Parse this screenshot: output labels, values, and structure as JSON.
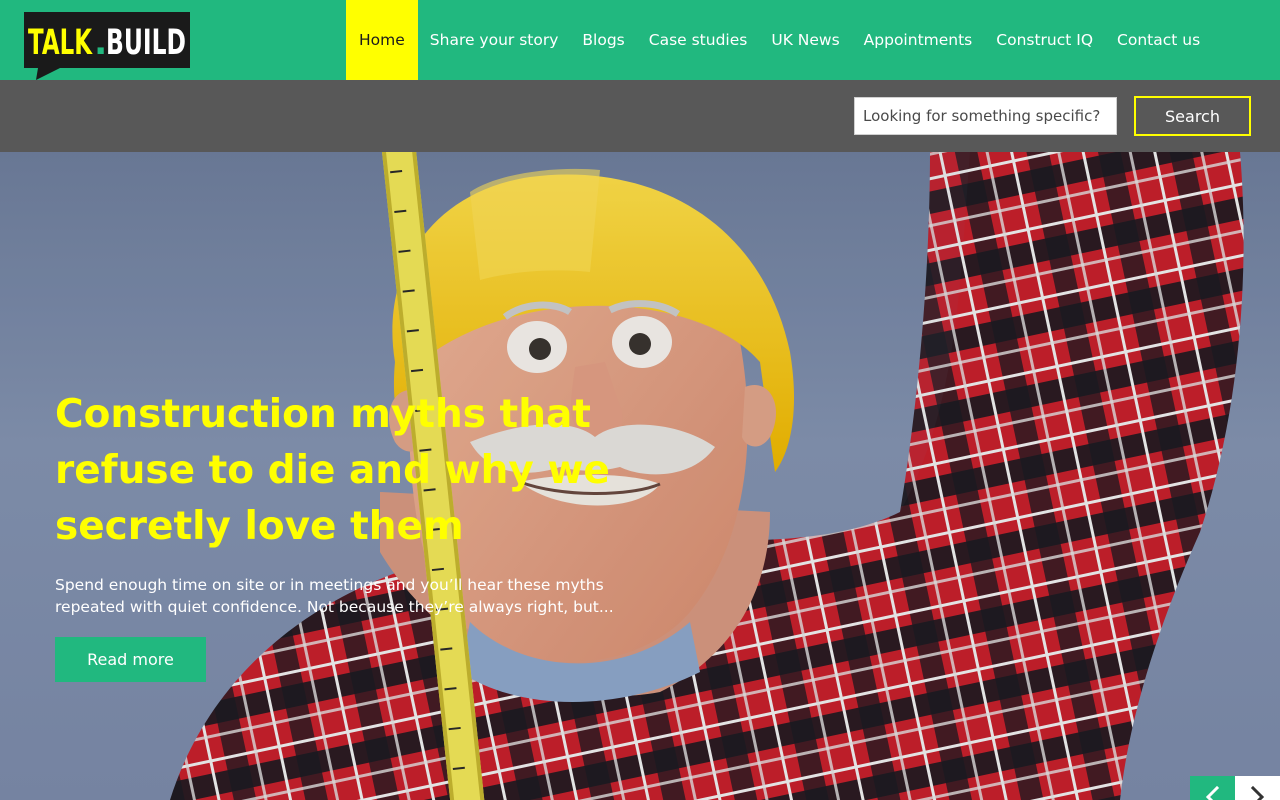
{
  "brand": {
    "logo_text_talk": "TALK",
    "logo_text_dot": ".",
    "logo_text_build": "BUILD",
    "accent_color": "#21b87f",
    "highlight_color": "#ffff00"
  },
  "nav": {
    "items": [
      {
        "label": "Home",
        "active": true
      },
      {
        "label": "Share your story",
        "active": false
      },
      {
        "label": "Blogs",
        "active": false
      },
      {
        "label": "Case studies",
        "active": false
      },
      {
        "label": "UK News",
        "active": false
      },
      {
        "label": "Appointments",
        "active": false
      },
      {
        "label": "Construct IQ",
        "active": false
      },
      {
        "label": "Contact us",
        "active": false
      }
    ]
  },
  "search": {
    "placeholder": "Looking for something specific?",
    "button_label": "Search"
  },
  "hero": {
    "title": "Construction myths that refuse to die and why we secretly love them",
    "excerpt": "Spend enough time on site or in meetings and you’ll hear these myths repeated with quiet confidence. Not because they’re always right, but...",
    "read_more_label": "Read more",
    "prev_icon": "chevron-left-icon",
    "next_icon": "chevron-right-icon"
  }
}
